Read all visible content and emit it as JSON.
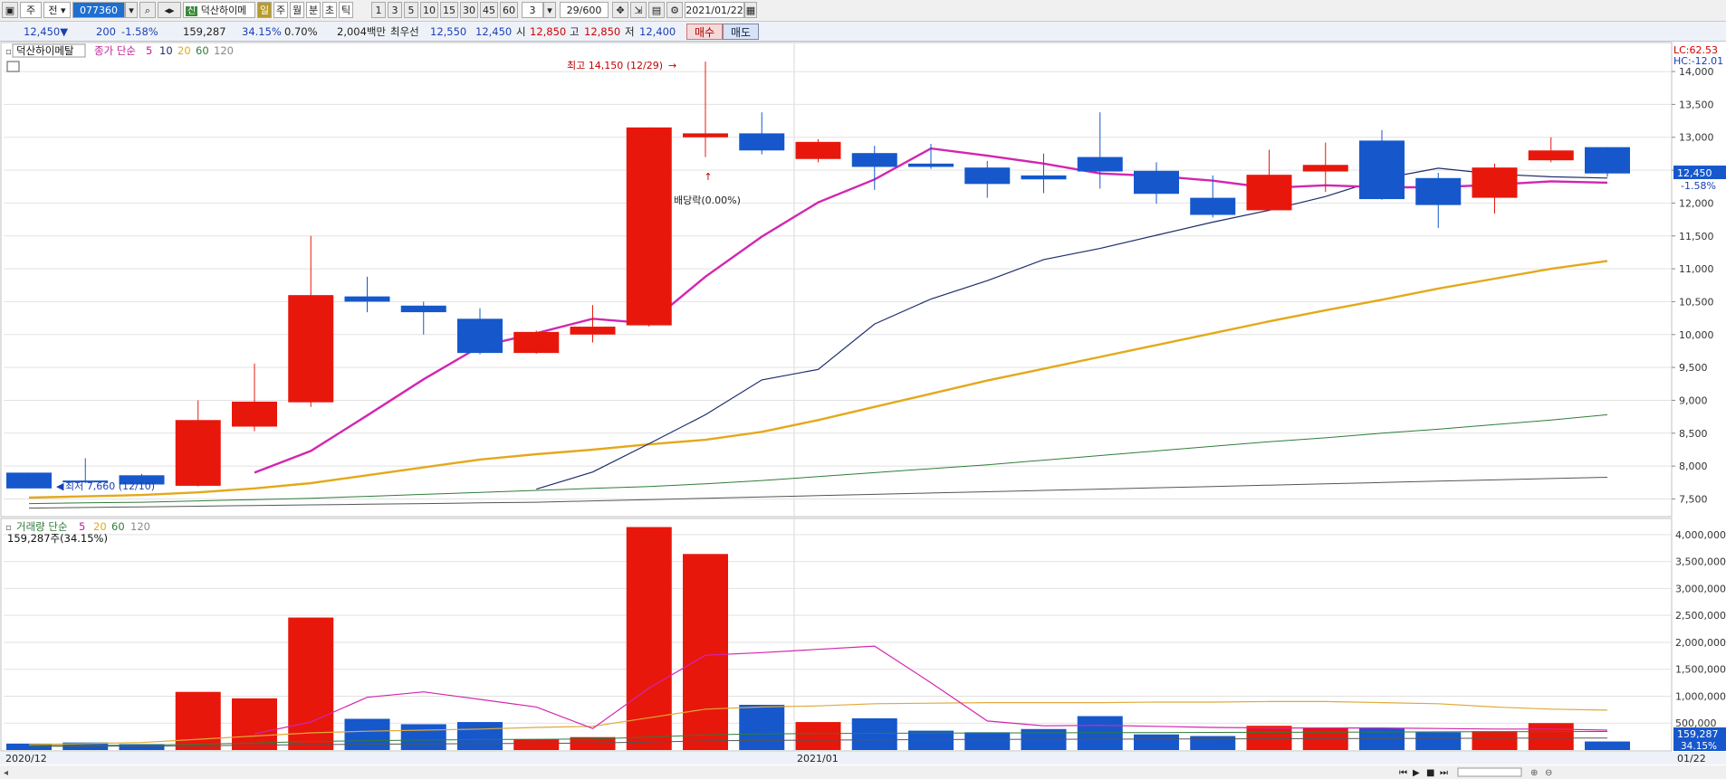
{
  "toolbar": {
    "btn_ju": "주",
    "btn_jeon": "전",
    "code_value": "077360",
    "stock_badge": "신",
    "stock_name": "덕산하이메",
    "period_day": "일",
    "period_week": "주",
    "period_month": "월",
    "period_min": "분",
    "period_sec": "초",
    "period_tick": "틱",
    "intervals": [
      "1",
      "3",
      "5",
      "10",
      "15",
      "30",
      "45",
      "60"
    ],
    "interval_value": "3",
    "count_value": "29/600",
    "date_value": "2021/01/22"
  },
  "quote": {
    "price": "12,450▼",
    "change": "200",
    "change_pct": "-1.58%",
    "volume": "159,287",
    "volume_ratio": "34.15%",
    "turnover": "0.70%",
    "amount": "2,004백만",
    "best_label": "최우선",
    "ask": "12,550",
    "bid": "12,450",
    "open_label": "시",
    "open": "12,850",
    "high_label": "고",
    "high": "12,850",
    "low_label": "저",
    "low": "12,400",
    "buy_label": "매수",
    "sell_label": "매도"
  },
  "price_legend": {
    "name": "덕산하이메탈",
    "label": "종가 단순",
    "p5": "5",
    "p10": "10",
    "p20": "20",
    "p60": "60",
    "p120": "120"
  },
  "volume_legend": {
    "label": "거래량 단순",
    "p5": "5",
    "p20": "20",
    "p60": "60",
    "p120": "120",
    "info": "159,287주(34.15%)"
  },
  "annotations": {
    "high": "최고 14,150 (12/29)",
    "low": "최저 7,660 (12/10)",
    "dividend": "배당락(0.00%)",
    "lc": "LC:62.53",
    "hc": "HC:-12.01",
    "current_price": "12,450",
    "current_pct": "-1.58%",
    "current_volume": "159,287",
    "current_volume_pct": "34.15%"
  },
  "x_axis": {
    "labels": [
      "2020/12",
      "2021/01",
      "01/22"
    ]
  },
  "colors": {
    "up": "#e8170c",
    "down": "#1658cc",
    "ma5": "#d226b0",
    "ma10": "#1d2d6b",
    "ma20": "#e3a91c",
    "ma60": "#2f7d3a",
    "ma120": "#555555",
    "vma20": "#e0a93a"
  },
  "chart_data": [
    {
      "type": "candlestick",
      "title": "덕산하이메탈 일봉",
      "price_ticks": [
        "7,500",
        "8,000",
        "8,500",
        "9,000",
        "9,500",
        "10,000",
        "10,500",
        "11,000",
        "11,500",
        "12,000",
        "12,500",
        "13,000",
        "13,500",
        "14,000"
      ],
      "ylim": [
        7300,
        14400
      ],
      "candles": [
        {
          "o": 7900,
          "c": 7660,
          "h": 7900,
          "l": 7660
        },
        {
          "o": 7780,
          "c": 7760,
          "h": 8120,
          "l": 7740
        },
        {
          "o": 7860,
          "c": 7720,
          "h": 7880,
          "l": 7700
        },
        {
          "o": 7700,
          "c": 8700,
          "h": 9000,
          "l": 7690
        },
        {
          "o": 8600,
          "c": 8980,
          "h": 9560,
          "l": 8530
        },
        {
          "o": 8970,
          "c": 10600,
          "h": 11500,
          "l": 8900
        },
        {
          "o": 10580,
          "c": 10500,
          "h": 10880,
          "l": 10340
        },
        {
          "o": 10440,
          "c": 10340,
          "h": 10500,
          "l": 10000
        },
        {
          "o": 10240,
          "c": 9720,
          "h": 10400,
          "l": 9700
        },
        {
          "o": 9720,
          "c": 10040,
          "h": 10060,
          "l": 9710
        },
        {
          "o": 10000,
          "c": 10120,
          "h": 10450,
          "l": 9880
        },
        {
          "o": 10140,
          "c": 13150,
          "h": 13150,
          "l": 10120
        },
        {
          "o": 13000,
          "c": 13060,
          "h": 14150,
          "l": 12700
        },
        {
          "o": 13060,
          "c": 12800,
          "h": 13380,
          "l": 12740
        },
        {
          "o": 12670,
          "c": 12930,
          "h": 12970,
          "l": 12620
        },
        {
          "o": 12760,
          "c": 12550,
          "h": 12870,
          "l": 12200
        },
        {
          "o": 12600,
          "c": 12550,
          "h": 12900,
          "l": 12520
        },
        {
          "o": 12540,
          "c": 12290,
          "h": 12640,
          "l": 12080
        },
        {
          "o": 12420,
          "c": 12360,
          "h": 12750,
          "l": 12150
        },
        {
          "o": 12700,
          "c": 12480,
          "h": 13380,
          "l": 12220
        },
        {
          "o": 12490,
          "c": 12140,
          "h": 12620,
          "l": 11990
        },
        {
          "o": 12080,
          "c": 11820,
          "h": 12420,
          "l": 11780
        },
        {
          "o": 11890,
          "c": 12430,
          "h": 12810,
          "l": 11880
        },
        {
          "o": 12480,
          "c": 12580,
          "h": 12920,
          "l": 12170
        },
        {
          "o": 12950,
          "c": 12060,
          "h": 13110,
          "l": 12050
        },
        {
          "o": 12380,
          "c": 11970,
          "h": 12460,
          "l": 11620
        },
        {
          "o": 12080,
          "c": 12540,
          "h": 12600,
          "l": 11840
        },
        {
          "o": 12650,
          "c": 12800,
          "h": 13000,
          "l": 12620
        },
        {
          "o": 12850,
          "c": 12450,
          "h": 12850,
          "l": 12400
        }
      ],
      "ma5": [
        null,
        null,
        null,
        null,
        7900,
        8230,
        8770,
        9320,
        9820,
        10020,
        10240,
        10170,
        10880,
        11490,
        12010,
        12360,
        12830,
        12720,
        12600,
        12450,
        12410,
        12340,
        12230,
        12270,
        12240,
        12240,
        12280,
        12330,
        12310
      ],
      "ma10": [
        null,
        null,
        null,
        null,
        null,
        null,
        null,
        null,
        null,
        7650,
        7910,
        8340,
        8780,
        9310,
        9470,
        10160,
        10540,
        10820,
        11140,
        11310,
        11510,
        11710,
        11890,
        12100,
        12370,
        12530,
        12440,
        12400,
        12380
      ],
      "ma20": [
        7520,
        7540,
        7560,
        7600,
        7660,
        7740,
        7860,
        7980,
        8100,
        8180,
        8250,
        8330,
        8400,
        8520,
        8700,
        8900,
        9100,
        9300,
        9480,
        9660,
        9840,
        10020,
        10200,
        10370,
        10530,
        10700,
        10850,
        11000,
        11120
      ],
      "ma60": [
        7430,
        7440,
        7450,
        7470,
        7490,
        7510,
        7540,
        7570,
        7600,
        7630,
        7660,
        7690,
        7730,
        7780,
        7840,
        7900,
        7960,
        8020,
        8090,
        8160,
        8230,
        8300,
        8370,
        8430,
        8500,
        8560,
        8630,
        8700,
        8780
      ],
      "ma120": [
        7360,
        7370,
        7380,
        7390,
        7400,
        7410,
        7420,
        7430,
        7440,
        7450,
        7470,
        7490,
        7510,
        7530,
        7550,
        7570,
        7590,
        7610,
        7630,
        7650,
        7670,
        7690,
        7710,
        7730,
        7750,
        7770,
        7790,
        7810,
        7830
      ]
    },
    {
      "type": "bar",
      "title": "거래량",
      "volume_ticks": [
        "500,000",
        "1,000,000",
        "1,500,000",
        "2,000,000",
        "2,500,000",
        "3,000,000",
        "3,500,000",
        "4,000,000"
      ],
      "ylim": [
        0,
        4250000
      ],
      "volumes": [
        120000,
        140000,
        110000,
        1080000,
        960000,
        2460000,
        580000,
        480000,
        520000,
        200000,
        240000,
        4140000,
        3640000,
        840000,
        520000,
        590000,
        360000,
        330000,
        390000,
        630000,
        290000,
        260000,
        450000,
        410000,
        410000,
        330000,
        350000,
        500000,
        159287
      ],
      "vma5": [
        null,
        null,
        null,
        null,
        300000,
        520000,
        980000,
        1080000,
        940000,
        800000,
        400000,
        1150000,
        1760000,
        1810000,
        1870000,
        1930000,
        1250000,
        540000,
        450000,
        460000,
        440000,
        420000,
        410000,
        410000,
        410000,
        400000,
        390000,
        390000,
        370000
      ],
      "vma20": [
        100000,
        120000,
        140000,
        200000,
        260000,
        320000,
        350000,
        370000,
        390000,
        420000,
        440000,
        600000,
        760000,
        800000,
        820000,
        860000,
        870000,
        880000,
        880000,
        880000,
        890000,
        890000,
        900000,
        900000,
        880000,
        860000,
        800000,
        760000,
        740000
      ],
      "vma60": [
        80000,
        85000,
        90000,
        110000,
        130000,
        160000,
        175000,
        185000,
        195000,
        200000,
        205000,
        240000,
        280000,
        300000,
        305000,
        310000,
        315000,
        318000,
        320000,
        322000,
        325000,
        328000,
        330000,
        332000,
        335000,
        337000,
        340000,
        342000,
        344000
      ],
      "vma120": [
        70000,
        72000,
        74000,
        80000,
        90000,
        100000,
        110000,
        115000,
        120000,
        125000,
        130000,
        150000,
        170000,
        180000,
        185000,
        190000,
        195000,
        198000,
        200000,
        202000,
        205000,
        207000,
        210000,
        212000,
        215000,
        217000,
        220000,
        222000,
        224000
      ]
    }
  ]
}
